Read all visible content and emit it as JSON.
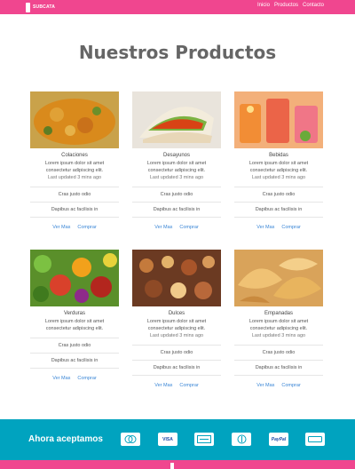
{
  "header": {
    "brand": "SUBCATA",
    "nav": [
      "Inicio",
      "Productos",
      "Contacto"
    ]
  },
  "main": {
    "title": "Nuestros Productos",
    "products": [
      {
        "name": "Colaciones",
        "desc_line1": "Lorem ipsum dolor sit amet",
        "desc_line2": "consectetur adipiscing elit.",
        "updated": "Last updated 3 mins ago",
        "row1": "Cras justo odio",
        "row2": "Dapibus ac facilisis in",
        "link1": "Ver Mas",
        "link2": "Comprar"
      },
      {
        "name": "Desayunos",
        "desc_line1": "Lorem ipsum dolor sit amet",
        "desc_line2": "consectetur adipiscing elit.",
        "updated": "Last updated 3 mins ago",
        "row1": "Cras justo odio",
        "row2": "Dapibus ac facilisis in",
        "link1": "Ver Mas",
        "link2": "Comprar"
      },
      {
        "name": "Bebidas",
        "desc_line1": "Lorem ipsum dolor sit amet",
        "desc_line2": "consectetur adipiscing elit.",
        "updated": "Last updated 3 mins ago",
        "row1": "Cras justo odio",
        "row2": "Dapibus ac facilisis in",
        "link1": "Ver Mas",
        "link2": "Comprar"
      },
      {
        "name": "Verduras",
        "desc_line1": "Lorem ipsum dolor sit amet",
        "desc_line2": "consectetur adipiscing elit.",
        "updated": "",
        "row1": "Cras justo odio",
        "row2": "Dapibus ac facilisis in",
        "link1": "Ver Mas",
        "link2": "Comprar"
      },
      {
        "name": "Dulces",
        "desc_line1": "Lorem ipsum dolor sit amet",
        "desc_line2": "consectetur adipiscing elit.",
        "updated": "Last updated 3 mins ago",
        "row1": "Cras justo odio",
        "row2": "Dapibus ac facilisis in",
        "link1": "Ver Mas",
        "link2": "Comprar"
      },
      {
        "name": "Empanadas",
        "desc_line1": "Lorem ipsum dolor sit amet",
        "desc_line2": "consectetur adipiscing elit.",
        "updated": "Last updated 3 mins ago",
        "row1": "Cras justo odio",
        "row2": "Dapibus ac facilisis in",
        "link1": "Ver Mas",
        "link2": "Comprar"
      }
    ]
  },
  "footer": {
    "label": "Ahora aceptamos",
    "payments": [
      {
        "icon": "mastercard-icon",
        "text": ""
      },
      {
        "icon": "visa-icon",
        "text": "VISA"
      },
      {
        "icon": "amex-icon",
        "text": ""
      },
      {
        "icon": "diners-icon",
        "text": ""
      },
      {
        "icon": "paypal-icon",
        "text": "PayPal"
      },
      {
        "icon": "discover-icon",
        "text": ""
      }
    ]
  },
  "colors": {
    "brand": "#f0468f",
    "footer": "#00a3bf",
    "link": "#3a86d6"
  }
}
